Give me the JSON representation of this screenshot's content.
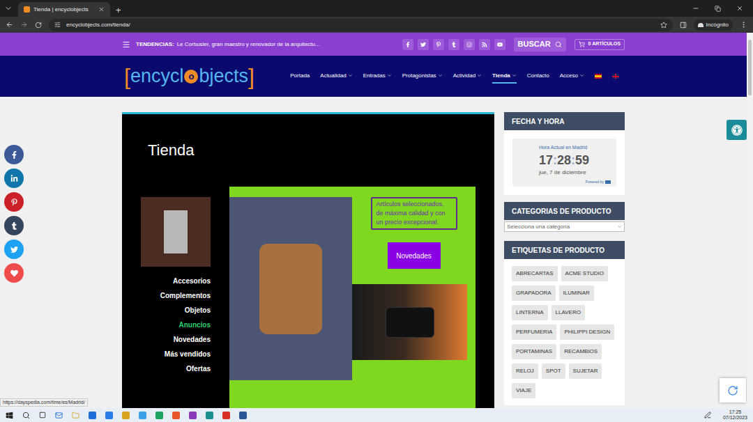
{
  "browser": {
    "tab_title": "Tienda | encyclobjects",
    "new_tab": "+",
    "url": "encyclobjects.com/tienda/",
    "incognito": "Incógnito"
  },
  "topbar": {
    "label": "TENDENCIAS:",
    "headline": "Le Corbusier, gran maestro y renovador de la arquitectu...",
    "search": "BUSCAR",
    "cart": "0 ARTÍCULOS"
  },
  "logo": {
    "open": "[",
    "before": "encycl",
    "mark": "o",
    "after": "bjects",
    "close": "]"
  },
  "nav": [
    {
      "label": "Portada",
      "dropdown": false,
      "selected": false
    },
    {
      "label": "Actualidad",
      "dropdown": true,
      "selected": false
    },
    {
      "label": "Entradas",
      "dropdown": true,
      "selected": false
    },
    {
      "label": "Protagonistas",
      "dropdown": true,
      "selected": false
    },
    {
      "label": "Actividad",
      "dropdown": true,
      "selected": false
    },
    {
      "label": "Tienda",
      "dropdown": true,
      "selected": true
    },
    {
      "label": "Contacto",
      "dropdown": false,
      "selected": false
    },
    {
      "label": "Acceso",
      "dropdown": true,
      "selected": false
    }
  ],
  "page": {
    "title": "Tienda",
    "links": [
      {
        "label": "Accesorios",
        "selected": false
      },
      {
        "label": "Complementos",
        "selected": false
      },
      {
        "label": "Objetos",
        "selected": false
      },
      {
        "label": "Anuncios",
        "selected": true
      },
      {
        "label": "Novedades",
        "selected": false
      },
      {
        "label": "Más vendidos",
        "selected": false
      },
      {
        "label": "Ofertas",
        "selected": false
      }
    ],
    "description": "Artículos seleccionados, de máxima calidad y con un precio excepcional.",
    "button": "Novedades"
  },
  "share": [
    {
      "color": "#3b5998"
    },
    {
      "color": "#0e76a8"
    },
    {
      "color": "#cb2027"
    },
    {
      "color": "#35465c"
    },
    {
      "color": "#1da1f2"
    },
    {
      "color": "#ef4b4b"
    }
  ],
  "sidebar": {
    "clock": {
      "header": "FECHA Y HORA",
      "caption": "Hora Actual en Madrid",
      "hours": "17",
      "minutes": "28",
      "seconds": "59",
      "separator": ":",
      "date": "jue, 7 de diciembre",
      "powered": "Powered by"
    },
    "categories": {
      "header": "CATEGORIAS DE PRODUCTO",
      "placeholder": "Selecciona una categoría"
    },
    "tags": {
      "header": "ETIQUETAS DE PRODUCTO",
      "items": [
        "ABRECARTAS",
        "ACME STUDIO",
        "GRAPADORA",
        "ILUMINAR",
        "LINTERNA",
        "LLAVERO",
        "PERFUMERIA",
        "PHILIPPI DESIGN",
        "PORTAMINAS",
        "RECAMBIOS",
        "RELOJ",
        "SPOT",
        "SUJETAR",
        "VIAJE"
      ]
    }
  },
  "status_url": "https://dayspedia.com/time/es/Madrid/",
  "taskbar": {
    "time": "17:25",
    "date": "07/12/2023"
  }
}
